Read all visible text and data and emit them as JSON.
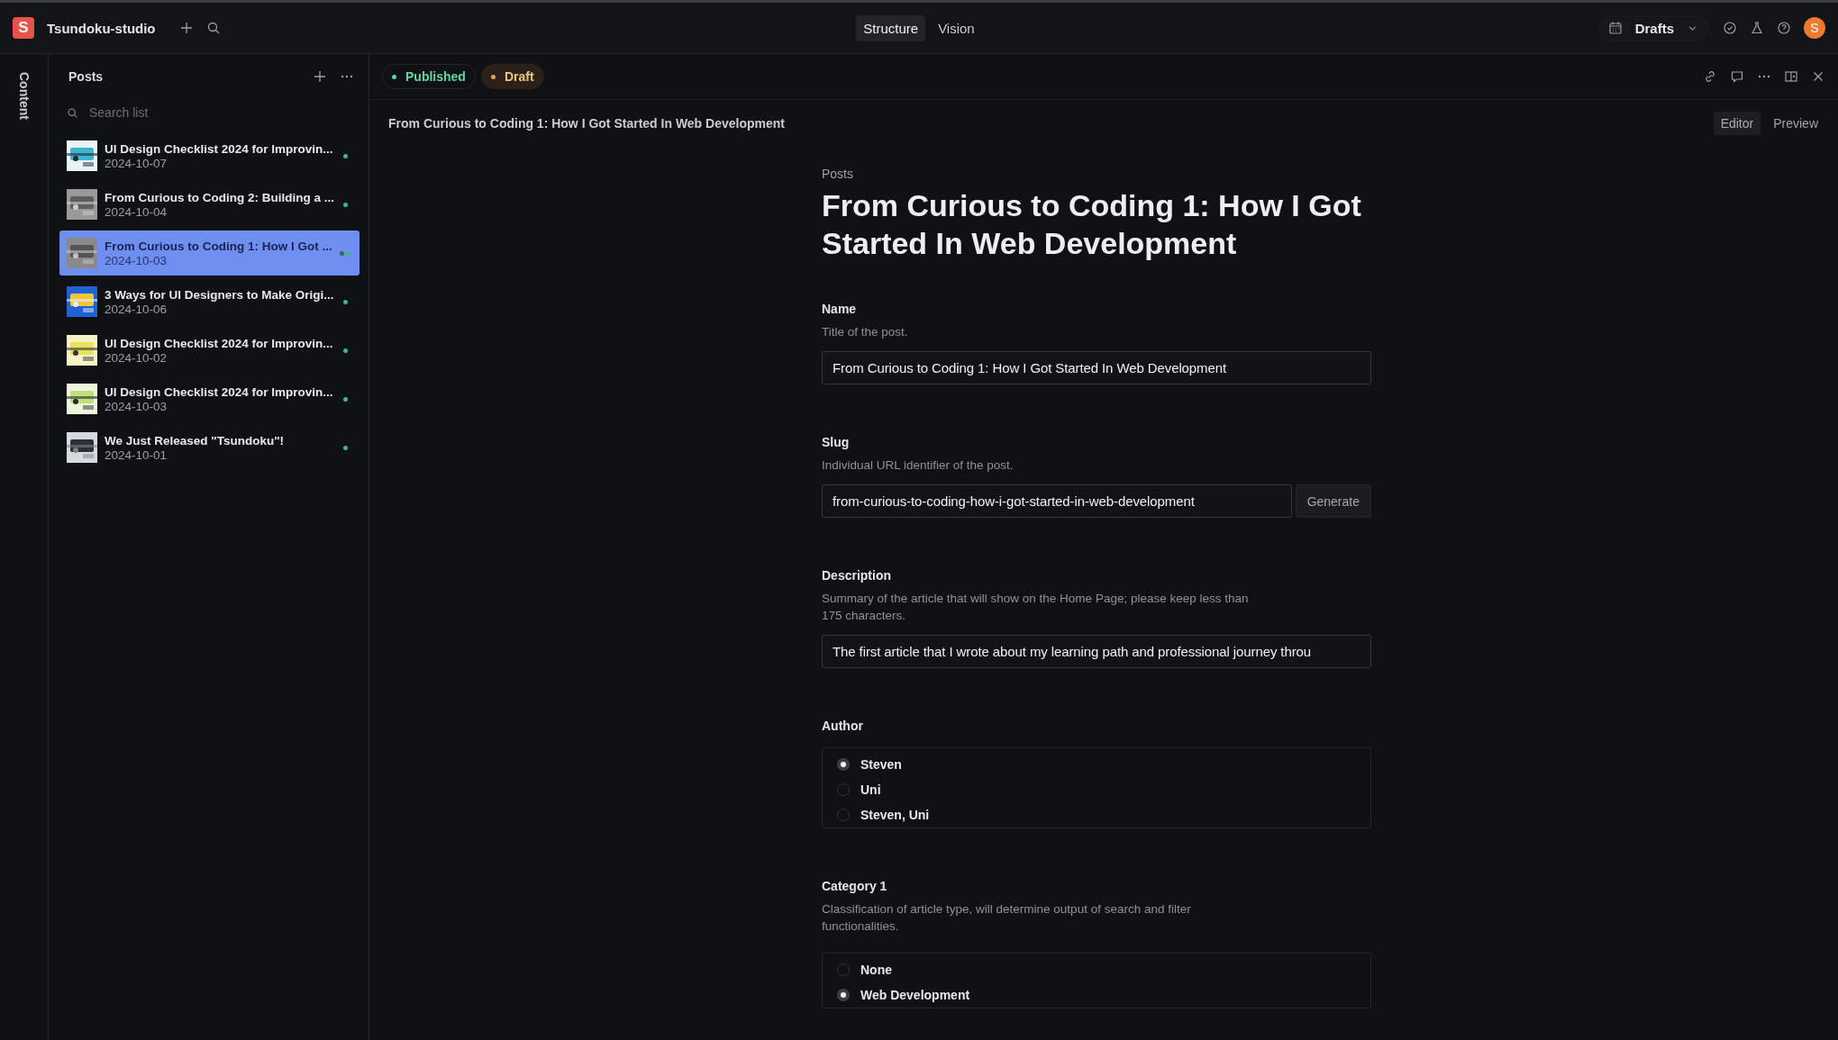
{
  "app": {
    "logo": "S",
    "name": "Tsundoku-studio"
  },
  "modes": [
    {
      "label": "Structure",
      "selected": true
    },
    {
      "label": "Vision",
      "selected": false
    }
  ],
  "release": {
    "label": "Drafts"
  },
  "avatar": {
    "initial": "S"
  },
  "rail": {
    "label": "Content"
  },
  "list": {
    "title": "Posts",
    "search": {
      "placeholder": "Search list"
    },
    "items": [
      {
        "title": "UI Design Checklist 2024 for Improvin...",
        "date": "2024-10-07",
        "selected": false,
        "draft": false
      },
      {
        "title": "From Curious to Coding 2: Building a ...",
        "date": "2024-10-04",
        "selected": false,
        "draft": false
      },
      {
        "title": "From Curious to Coding 1: How I Got ...",
        "date": "2024-10-03",
        "selected": true,
        "draft": true
      },
      {
        "title": "3 Ways for UI Designers to Make Origi...",
        "date": "2024-10-06",
        "selected": false,
        "draft": false
      },
      {
        "title": "UI Design Checklist 2024 for Improvin...",
        "date": "2024-10-02",
        "selected": false,
        "draft": false
      },
      {
        "title": "UI Design Checklist 2024 for Improvin...",
        "date": "2024-10-03",
        "selected": false,
        "draft": false
      },
      {
        "title": "We Just Released \"Tsundoku\"!",
        "date": "2024-10-01",
        "selected": false,
        "draft": false
      }
    ]
  },
  "document": {
    "statuses": [
      {
        "label": "Published",
        "kind": "published",
        "selected": false
      },
      {
        "label": "Draft",
        "kind": "draft",
        "selected": true
      }
    ],
    "header_title": "From Curious to Coding 1: How I Got Started In Web Development",
    "views": [
      {
        "label": "Editor",
        "selected": true
      },
      {
        "label": "Preview",
        "selected": false
      }
    ],
    "breadcrumb": "Posts",
    "title": "From Curious to Coding 1: How I Got Started In Web Development",
    "fields": [
      {
        "kind": "text",
        "label": "Name",
        "help": "Title of the post.",
        "value": "From Curious to Coding 1: How I Got Started In Web Development"
      },
      {
        "kind": "slug",
        "label": "Slug",
        "help": "Individual URL identifier of the post.",
        "value": "from-curious-to-coding-how-i-got-started-in-web-development",
        "button": "Generate"
      },
      {
        "kind": "text",
        "label": "Description",
        "help": "Summary of the article that will show on the Home Page; please keep less than 175 characters.",
        "value": "The first article that I wrote about my learning path and professional journey throu"
      },
      {
        "kind": "radio",
        "label": "Author",
        "options": [
          {
            "label": "Steven",
            "selected": true
          },
          {
            "label": "Uni",
            "selected": false
          },
          {
            "label": "Steven, Uni",
            "selected": false
          }
        ]
      },
      {
        "kind": "radio",
        "label": "Category 1",
        "help": "Classification of article type, will determine output of search and filter functionalities.",
        "options": [
          {
            "label": "None",
            "selected": false
          },
          {
            "label": "Web Development",
            "selected": true
          }
        ]
      }
    ]
  }
}
